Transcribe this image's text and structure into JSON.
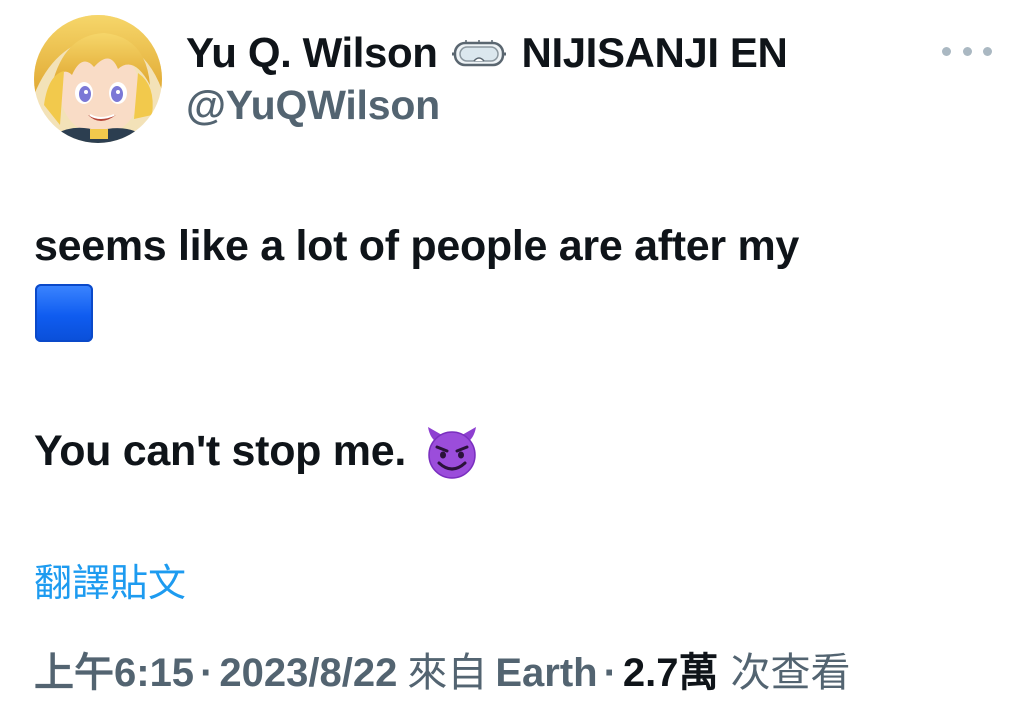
{
  "author": {
    "display_name": "Yu Q. Wilson",
    "affiliation": "NIJISANJI EN",
    "handle": "@YuQWilson",
    "avatar": "blonde-anime-character-avatar",
    "badge_icon": "goggles-icon"
  },
  "menu": {
    "icon": "more-horizontal-icon"
  },
  "tweet": {
    "line1": "seems like a lot of people are after my",
    "line1_emoji": "blue-square-emoji",
    "line2": "You can't stop me.",
    "line2_emoji": "smiling-devil-emoji"
  },
  "translate": {
    "label": "翻譯貼文"
  },
  "meta": {
    "time": "上午6:15",
    "separator": "·",
    "date": "2023/8/22",
    "source_prefix": "來自",
    "source": "Earth",
    "views_count": "2.7萬",
    "views_label": "次查看"
  },
  "colors": {
    "text_primary": "#0f1419",
    "text_secondary": "#536471",
    "link": "#1d9bf0",
    "blue_square": "#1560f5",
    "devil": "#8e3fd1"
  }
}
